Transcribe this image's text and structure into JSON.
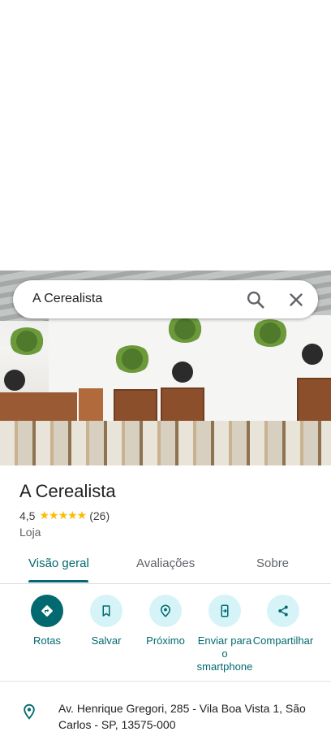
{
  "search": {
    "query": "A Cerealista"
  },
  "place": {
    "name": "A Cerealista",
    "rating": "4,5",
    "stars": "★★★★★",
    "reviews_count": "(26)",
    "category": "Loja"
  },
  "tabs": [
    {
      "label": "Visão geral",
      "active": true
    },
    {
      "label": "Avaliações",
      "active": false
    },
    {
      "label": "Sobre",
      "active": false
    }
  ],
  "actions": [
    {
      "label": "Rotas",
      "icon": "directions-icon"
    },
    {
      "label": "Salvar",
      "icon": "bookmark-icon"
    },
    {
      "label": "Próximo",
      "icon": "nearby-icon"
    },
    {
      "label": "Enviar para o smartphone",
      "icon": "send-to-phone-icon"
    },
    {
      "label": "Compartilhar",
      "icon": "share-icon"
    }
  ],
  "address": "Av. Henrique Gregori, 285 - Vila Boa Vista 1, São Carlos - SP, 13575-000",
  "colors": {
    "accent": "#01696f",
    "accent_light": "#d6f4f7",
    "star": "#fbbc04"
  }
}
